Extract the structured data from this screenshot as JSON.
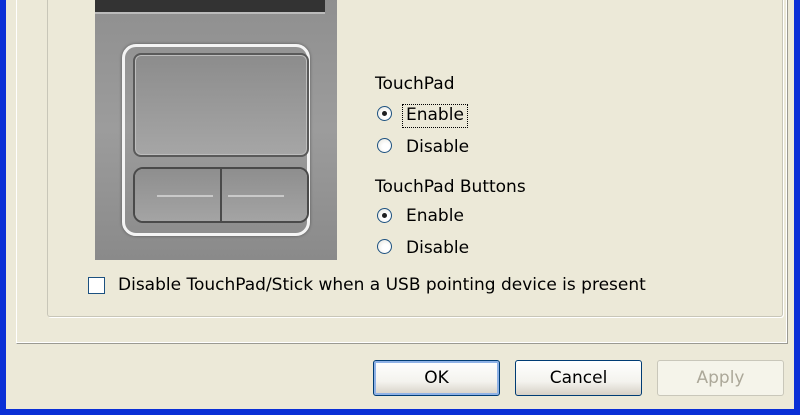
{
  "touchpad": {
    "heading": "TouchPad",
    "options": [
      {
        "label": "Enable",
        "checked": true,
        "focused": true
      },
      {
        "label": "Disable",
        "checked": false
      }
    ]
  },
  "touchpad_buttons": {
    "heading": "TouchPad Buttons",
    "options": [
      {
        "label": "Enable",
        "checked": true
      },
      {
        "label": "Disable",
        "checked": false
      }
    ]
  },
  "usb_option": {
    "label": "Disable TouchPad/Stick when a USB pointing device is present",
    "checked": false
  },
  "buttons": {
    "ok": "OK",
    "cancel": "Cancel",
    "apply": "Apply"
  },
  "colors": {
    "window_frame": "#0a2fd6",
    "dialog_bg": "#ece9d8",
    "disabled_text": "#aca899"
  }
}
